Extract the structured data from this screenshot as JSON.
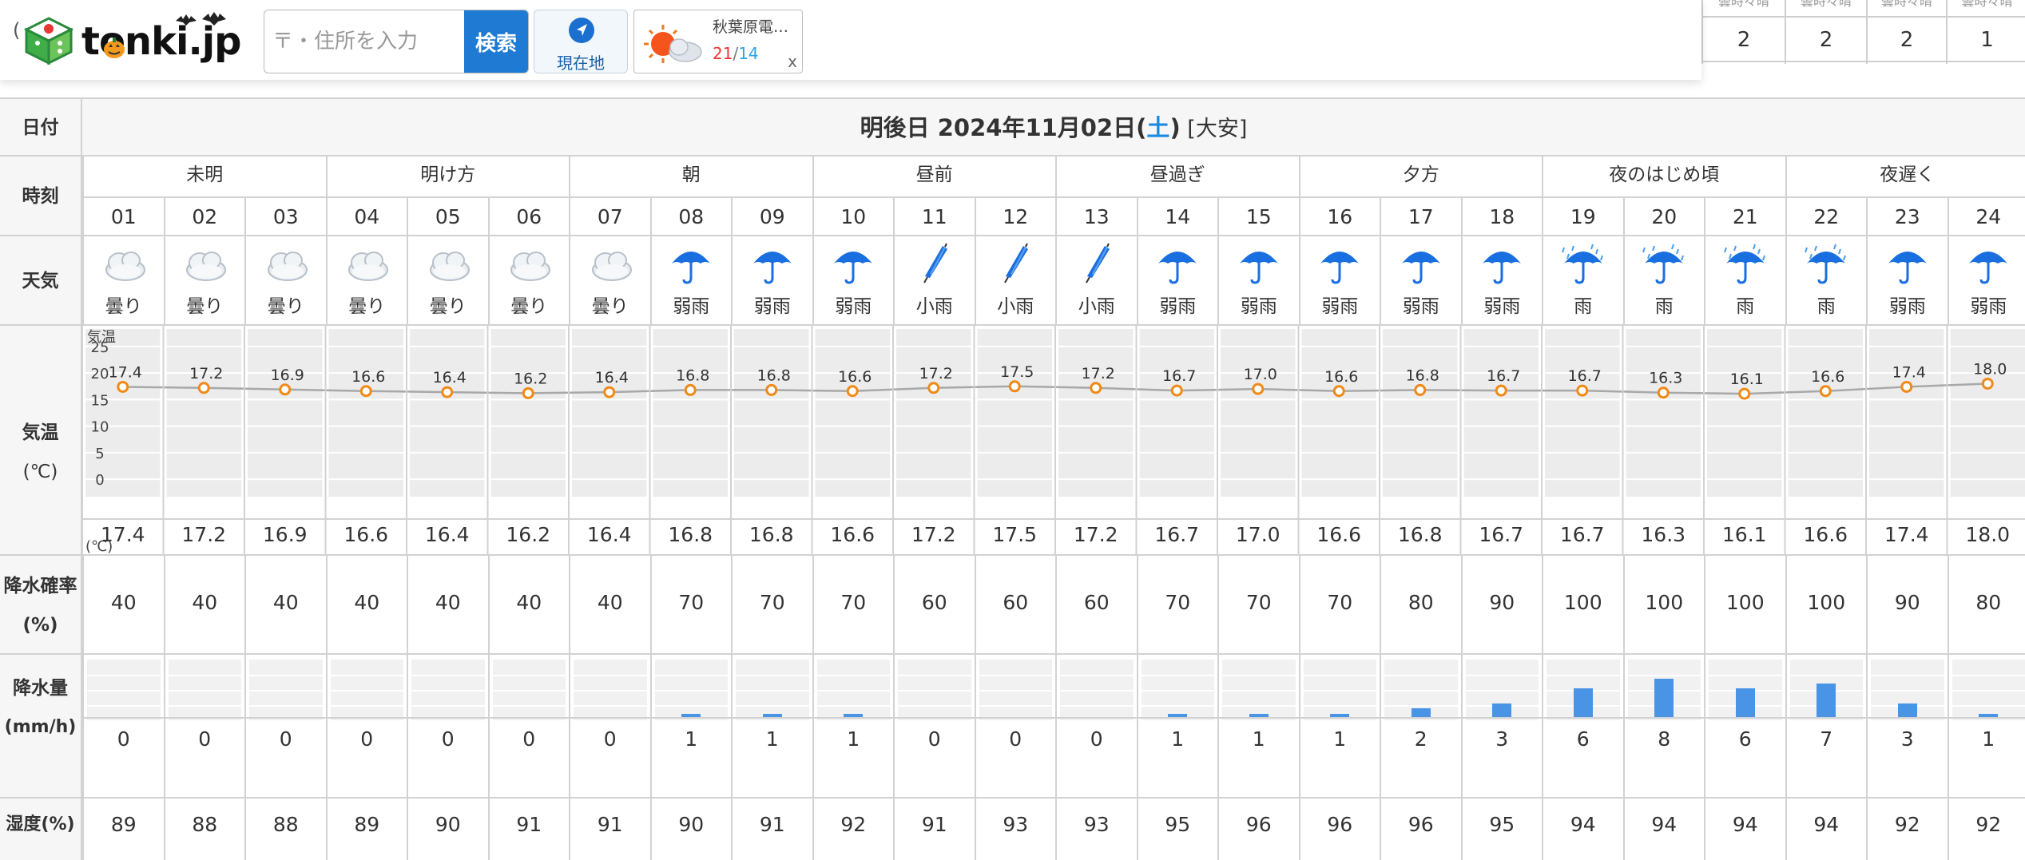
{
  "header": {
    "left_paren": "(",
    "logo_text": "tonki.jp",
    "search_placeholder": "〒・住所を入力",
    "search_button": "検索",
    "current_location": "現在地",
    "mini_place": "秋葉原電…",
    "mini_high": "21",
    "mini_sep": "/",
    "mini_low": "14",
    "mini_close": "x"
  },
  "topright": {
    "headers": [
      "曇時々晴",
      "曇時々晴",
      "曇時々晴",
      "曇時々晴"
    ],
    "values": [
      "2",
      "2",
      "2",
      "1"
    ]
  },
  "labels": {
    "date": "日付",
    "time": "時刻",
    "weather": "天気",
    "temp_line1": "気温",
    "temp_line2": "(℃)",
    "precip_prob_line1": "降水確率",
    "precip_prob_line2": "(%)",
    "precip_amt_line1": "降水量",
    "precip_amt_line2": "(mm/h)",
    "humidity": "湿度(%)"
  },
  "date": {
    "prefix": "明後日 2024年11月02日(",
    "weekday": "土",
    "suffix": ")",
    "rokuyo": " [大安]"
  },
  "periods": [
    {
      "label": "未明",
      "span": 3
    },
    {
      "label": "明け方",
      "span": 3
    },
    {
      "label": "朝",
      "span": 3
    },
    {
      "label": "昼前",
      "span": 3
    },
    {
      "label": "昼過ぎ",
      "span": 3
    },
    {
      "label": "夕方",
      "span": 3
    },
    {
      "label": "夜のはじめ頃",
      "span": 3
    },
    {
      "label": "夜遅く",
      "span": 3
    }
  ],
  "hours": [
    "01",
    "02",
    "03",
    "04",
    "05",
    "06",
    "07",
    "08",
    "09",
    "10",
    "11",
    "12",
    "13",
    "14",
    "15",
    "16",
    "17",
    "18",
    "19",
    "20",
    "21",
    "22",
    "23",
    "24"
  ],
  "weather": [
    {
      "text": "曇り",
      "icon": "cloud-icon"
    },
    {
      "text": "曇り",
      "icon": "cloud-icon"
    },
    {
      "text": "曇り",
      "icon": "cloud-icon"
    },
    {
      "text": "曇り",
      "icon": "cloud-icon"
    },
    {
      "text": "曇り",
      "icon": "cloud-icon"
    },
    {
      "text": "曇り",
      "icon": "cloud-icon"
    },
    {
      "text": "曇り",
      "icon": "cloud-icon"
    },
    {
      "text": "弱雨",
      "icon": "umbrella-icon"
    },
    {
      "text": "弱雨",
      "icon": "umbrella-icon"
    },
    {
      "text": "弱雨",
      "icon": "umbrella-icon"
    },
    {
      "text": "小雨",
      "icon": "closed-umbrella-icon"
    },
    {
      "text": "小雨",
      "icon": "closed-umbrella-icon"
    },
    {
      "text": "小雨",
      "icon": "closed-umbrella-icon"
    },
    {
      "text": "弱雨",
      "icon": "umbrella-icon"
    },
    {
      "text": "弱雨",
      "icon": "umbrella-icon"
    },
    {
      "text": "弱雨",
      "icon": "umbrella-icon"
    },
    {
      "text": "弱雨",
      "icon": "umbrella-icon"
    },
    {
      "text": "弱雨",
      "icon": "umbrella-icon"
    },
    {
      "text": "雨",
      "icon": "rain-umbrella-icon"
    },
    {
      "text": "雨",
      "icon": "rain-umbrella-icon"
    },
    {
      "text": "雨",
      "icon": "rain-umbrella-icon"
    },
    {
      "text": "雨",
      "icon": "rain-umbrella-icon"
    },
    {
      "text": "弱雨",
      "icon": "umbrella-icon"
    },
    {
      "text": "弱雨",
      "icon": "umbrella-icon"
    }
  ],
  "temps": [
    "17.4",
    "17.2",
    "16.9",
    "16.6",
    "16.4",
    "16.2",
    "16.4",
    "16.8",
    "16.8",
    "16.6",
    "17.2",
    "17.5",
    "17.2",
    "16.7",
    "17.0",
    "16.6",
    "16.8",
    "16.7",
    "16.7",
    "16.3",
    "16.1",
    "16.6",
    "17.4",
    "18.0"
  ],
  "precip_prob": [
    "40",
    "40",
    "40",
    "40",
    "40",
    "40",
    "40",
    "70",
    "70",
    "70",
    "60",
    "60",
    "60",
    "70",
    "70",
    "70",
    "80",
    "90",
    "100",
    "100",
    "100",
    "100",
    "90",
    "80"
  ],
  "precip_amt": [
    "0",
    "0",
    "0",
    "0",
    "0",
    "0",
    "0",
    "1",
    "1",
    "1",
    "0",
    "0",
    "0",
    "1",
    "1",
    "1",
    "2",
    "3",
    "6",
    "8",
    "6",
    "7",
    "3",
    "1"
  ],
  "humidity": [
    "89",
    "88",
    "88",
    "89",
    "90",
    "91",
    "91",
    "90",
    "91",
    "92",
    "91",
    "93",
    "93",
    "95",
    "96",
    "96",
    "96",
    "95",
    "94",
    "94",
    "94",
    "94",
    "92",
    "92"
  ],
  "chart_data": {
    "type": "line",
    "x": [
      "01",
      "02",
      "03",
      "04",
      "05",
      "06",
      "07",
      "08",
      "09",
      "10",
      "11",
      "12",
      "13",
      "14",
      "15",
      "16",
      "17",
      "18",
      "19",
      "20",
      "21",
      "22",
      "23",
      "24"
    ],
    "series": [
      {
        "name": "気温",
        "values": [
          17.4,
          17.2,
          16.9,
          16.6,
          16.4,
          16.2,
          16.4,
          16.8,
          16.8,
          16.6,
          17.2,
          17.5,
          17.2,
          16.7,
          17.0,
          16.6,
          16.8,
          16.7,
          16.7,
          16.3,
          16.1,
          16.6,
          17.4,
          18.0
        ]
      }
    ],
    "ylabel": "気温",
    "yunit": "(℃)",
    "yticks": [
      "25",
      "20",
      "15",
      "10",
      "5",
      "0"
    ],
    "ylim": [
      -3,
      28
    ],
    "grid": true,
    "line_color": "#a8a8a8",
    "marker_color": "#f08a17"
  },
  "colors": {
    "search_button": "#1f7ad3",
    "saturday": "#1a8be0",
    "precip_bar": "#4a94e6",
    "umbrella": "#1a6fe0",
    "temp_marker": "#f08a17"
  }
}
